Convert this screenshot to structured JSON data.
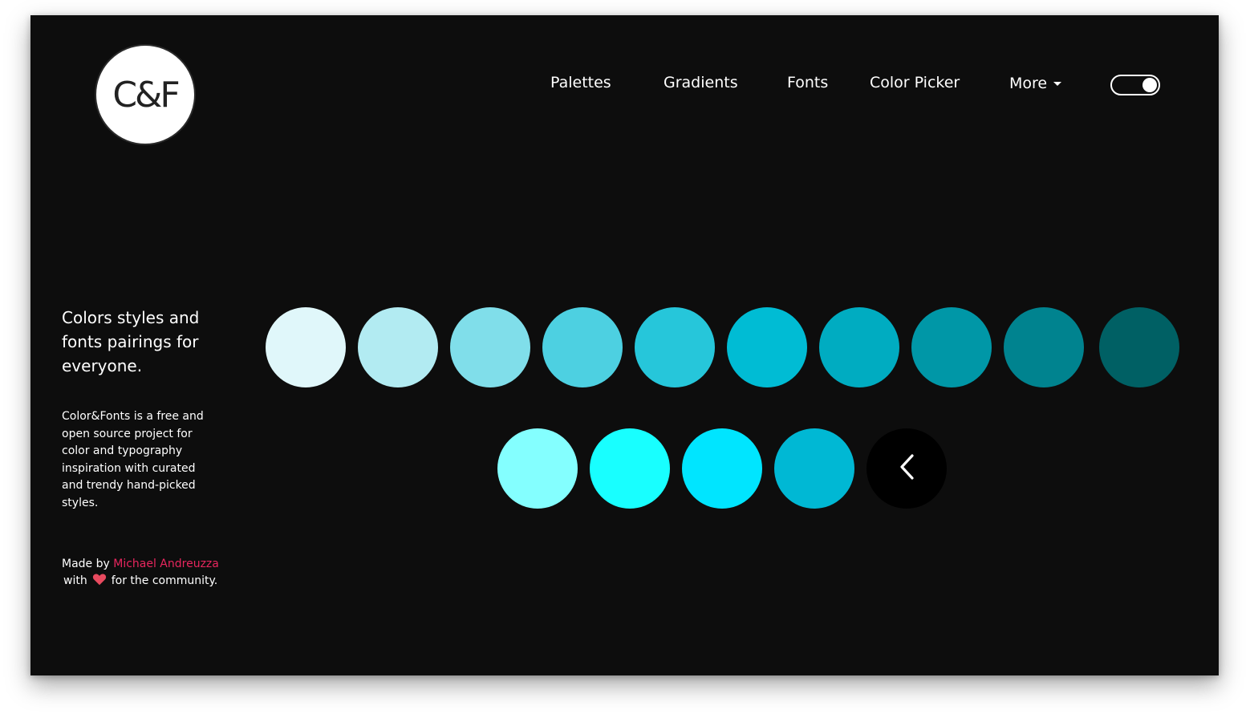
{
  "logo": {
    "text": "C&F"
  },
  "nav": {
    "items": [
      {
        "label": "Palettes"
      },
      {
        "label": "Gradients"
      },
      {
        "label": "Fonts"
      },
      {
        "label": "Color Picker"
      },
      {
        "label": "More"
      }
    ]
  },
  "theme_toggle": {
    "state": "on"
  },
  "sidebar": {
    "tagline": "Colors styles and fonts pairings for everyone.",
    "description": "Color&Fonts is a free and open source project for color and typography inspiration with curated and trendy hand-picked styles.",
    "credit": {
      "prefix": "Made by",
      "author": "Michael Andreuzza",
      "with": "with",
      "suffix": "for the  community."
    }
  },
  "palette": {
    "row1": [
      "#e0f7fa",
      "#b2ebf2",
      "#80deea",
      "#4dd0e1",
      "#26c6da",
      "#00bcd4",
      "#00acc1",
      "#0097a7",
      "#00838f",
      "#006064"
    ],
    "row2": [
      "#84ffff",
      "#18ffff",
      "#00e5ff",
      "#00b8d4"
    ]
  },
  "colors": {
    "background": "#0d0d0d",
    "accent": "#e8265e",
    "heart": "#e84a5f"
  }
}
